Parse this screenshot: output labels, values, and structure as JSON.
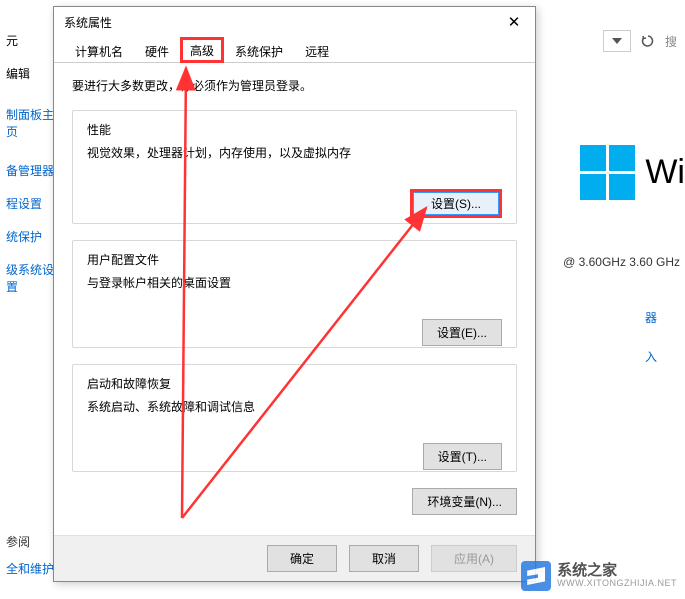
{
  "background": {
    "menu_edit": "编辑",
    "top_left_char": "元",
    "left_items": [
      "制面板主页",
      "备管理器",
      "程设置",
      "统保护",
      "级系统设置"
    ],
    "search_label": "搜",
    "win_text": "Wi",
    "ghz_text": "@ 3.60GHz   3.60 GHz",
    "right_misc": [
      "器",
      "入"
    ],
    "bottom_left": [
      "参阅",
      "全和维护"
    ]
  },
  "dialog": {
    "title": "系统属性",
    "tabs": [
      "计算机名",
      "硬件",
      "高级",
      "系统保护",
      "远程"
    ],
    "active_tab_index": 2,
    "admin_msg": "要进行大多数更改，你必须作为管理员登录。",
    "groups": {
      "performance": {
        "legend": "性能",
        "desc": "视觉效果，处理器计划，内存使用，以及虚拟内存",
        "button": "设置(S)..."
      },
      "user_profile": {
        "legend": "用户配置文件",
        "desc": "与登录帐户相关的桌面设置",
        "button": "设置(E)..."
      },
      "startup_recovery": {
        "legend": "启动和故障恢复",
        "desc": "系统启动、系统故障和调试信息",
        "button": "设置(T)..."
      }
    },
    "env_var_button": "环境变量(N)...",
    "footer": {
      "ok": "确定",
      "cancel": "取消",
      "apply": "应用(A)"
    }
  },
  "watermark": {
    "line1": "系统之家",
    "line2": "WWW.XITONGZHIJIA.NET"
  },
  "annotation": {
    "highlight_tab": true,
    "highlight_perf_button": true
  }
}
